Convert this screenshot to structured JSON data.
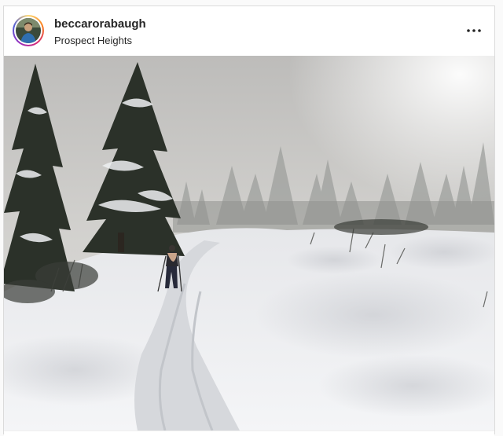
{
  "post": {
    "username": "beccarorabaugh",
    "location": "Prospect Heights"
  },
  "icons": {
    "more": "more-options-icon",
    "avatar": "profile-avatar"
  },
  "colors": {
    "story_ring": [
      "#feda75",
      "#fa7e1e",
      "#d62976",
      "#962fbf",
      "#4f5bd5"
    ],
    "text": "#262626",
    "border": "#dbdbdb"
  }
}
